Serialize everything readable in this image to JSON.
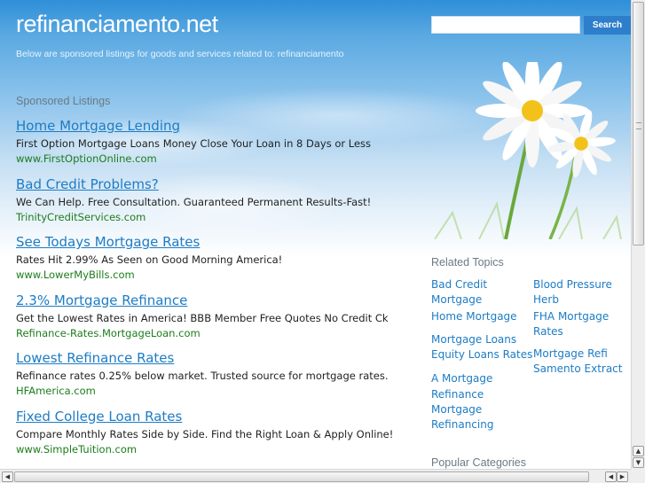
{
  "header": {
    "site_title": "refinanciamento.net",
    "tagline": "Below are sponsored listings for goods and services related to: refinanciamento",
    "search_placeholder": "",
    "search_button": "Search"
  },
  "sponsored": {
    "heading": "Sponsored Listings",
    "listings": [
      {
        "title": "Home Mortgage Lending",
        "desc": "First Option Mortgage Loans Money Close Your Loan in 8 Days or Less",
        "url": "www.FirstOptionOnline.com"
      },
      {
        "title": "Bad Credit Problems?",
        "desc": "We Can Help. Free Consultation. Guaranteed Permanent Results-Fast!",
        "url": "TrinityCreditServices.com"
      },
      {
        "title": "See Todays Mortgage Rates",
        "desc": "Rates Hit 2.99% As Seen on Good Morning America!",
        "url": "www.LowerMyBills.com"
      },
      {
        "title": "2.3% Mortgage Refinance",
        "desc": "Get the Lowest Rates in America! BBB Member Free Quotes No Credit Ck",
        "url": "Refinance-Rates.MortgageLoan.com"
      },
      {
        "title": "Lowest Refinance Rates",
        "desc": "Refinance rates 0.25% below market. Trusted source for mortgage rates.",
        "url": "HFAmerica.com"
      },
      {
        "title": "Fixed College Loan Rates",
        "desc": "Compare Monthly Rates Side by Side. Find the Right Loan & Apply Online!",
        "url": "www.SimpleTuition.com"
      }
    ]
  },
  "related": {
    "heading": "Related Topics",
    "col1": [
      "Bad Credit Mortgage",
      "Home Mortgage",
      "Mortgage Loans",
      "Equity Loans Rates",
      "A Mortgage Refinance",
      "Mortgage Refinancing"
    ],
    "col2": [
      "Blood Pressure Herb",
      "FHA Mortgage Rates",
      "Mortgage Refi",
      "Samento Extract"
    ]
  },
  "popular": {
    "heading": "Popular Categories"
  },
  "colors": {
    "link": "#1d7cc4",
    "url_green": "#1c7d1c",
    "button_blue": "#2d7ecb"
  }
}
